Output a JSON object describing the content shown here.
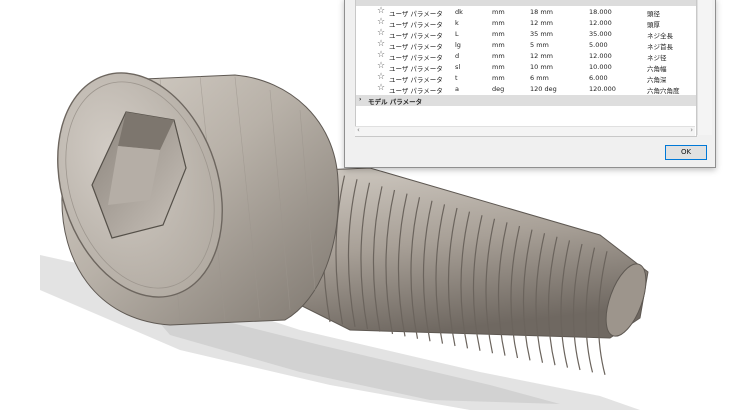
{
  "dialog": {
    "ok_label": "OK",
    "rows": [
      {
        "type": "ユーザ パラメータ",
        "name": "dk",
        "unit": "mm",
        "expression": "18 mm",
        "value": "18.000",
        "comment": "頭径"
      },
      {
        "type": "ユーザ パラメータ",
        "name": "k",
        "unit": "mm",
        "expression": "12 mm",
        "value": "12.000",
        "comment": "頭厚"
      },
      {
        "type": "ユーザ パラメータ",
        "name": "L",
        "unit": "mm",
        "expression": "35 mm",
        "value": "35.000",
        "comment": "ネジ全長"
      },
      {
        "type": "ユーザ パラメータ",
        "name": "lg",
        "unit": "mm",
        "expression": "5 mm",
        "value": "5.000",
        "comment": "ネジ首長"
      },
      {
        "type": "ユーザ パラメータ",
        "name": "d",
        "unit": "mm",
        "expression": "12 mm",
        "value": "12.000",
        "comment": "ネジ径"
      },
      {
        "type": "ユーザ パラメータ",
        "name": "sl",
        "unit": "mm",
        "expression": "10 mm",
        "value": "10.000",
        "comment": "六角幅"
      },
      {
        "type": "ユーザ パラメータ",
        "name": "t",
        "unit": "mm",
        "expression": "6 mm",
        "value": "6.000",
        "comment": "六角深"
      },
      {
        "type": "ユーザ パラメータ",
        "name": "a",
        "unit": "deg",
        "expression": "120 deg",
        "value": "120.000",
        "comment": "六角穴角度"
      }
    ],
    "model_group_label": "モデル パラメータ"
  },
  "icons": {
    "favorite": "star-outline-icon",
    "expand": "chevron-right-icon",
    "scroll_left": "scroll-left-icon",
    "scroll_right": "scroll-right-icon"
  },
  "colors": {
    "metal_light": "#c9c3bb",
    "metal_mid": "#a59d94",
    "metal_dark": "#6d665f",
    "shadow": "#dcdcdc",
    "dialog_bg": "#f0f0f0",
    "ok_border": "#0078d7"
  }
}
